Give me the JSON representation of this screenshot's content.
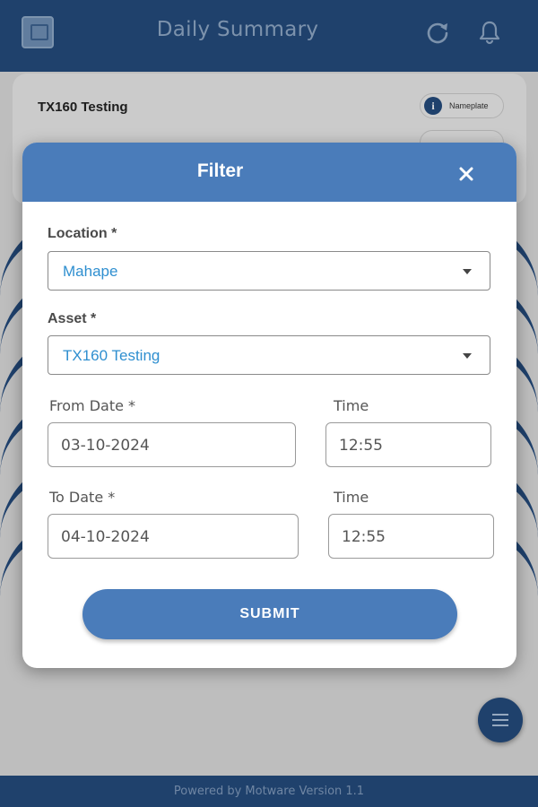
{
  "app": {
    "title": "Daily Summary",
    "footer": "Powered by Motware Version 1.1",
    "background_card": {
      "title": "TX160 Testing",
      "nameplate_chip": "Nameplate"
    }
  },
  "filter_modal": {
    "title": "Filter",
    "location": {
      "label": "Location *",
      "value": "Mahape"
    },
    "asset": {
      "label": "Asset *",
      "value": "TX160 Testing"
    },
    "from_date": {
      "label": "From Date *",
      "value": "03-10-2024"
    },
    "from_time": {
      "label": "Time",
      "value": "12:55"
    },
    "to_date": {
      "label": "To Date *",
      "value": "04-10-2024"
    },
    "to_time": {
      "label": "Time",
      "value": "12:55"
    },
    "submit_label": "SUBMIT"
  },
  "colors": {
    "primary_dark": "#244a7c",
    "modal_header": "#4a7cba",
    "select_value": "#2f8fd0"
  },
  "icons": {
    "refresh": "refresh-icon",
    "notifications": "bell-icon",
    "close": "close-icon",
    "menu": "menu-icon",
    "info": "info-icon"
  }
}
